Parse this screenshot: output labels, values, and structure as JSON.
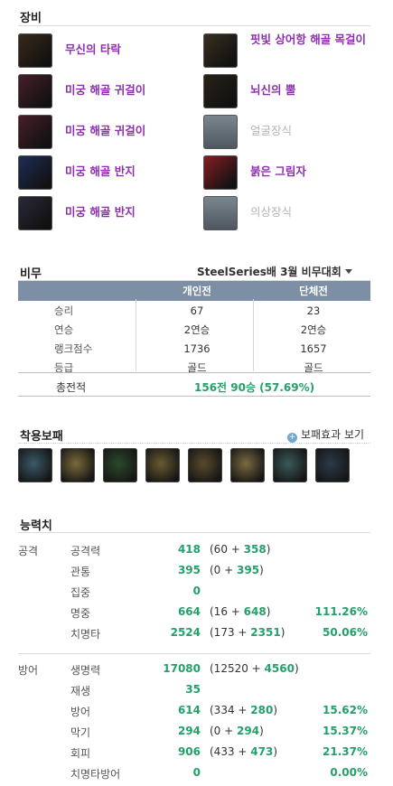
{
  "equipment": {
    "title": "장비",
    "left": [
      {
        "name": "무신의 타락",
        "icon": "weapon-icon",
        "color": "#3a2a1a"
      },
      {
        "name": "미궁 해골 귀걸이",
        "icon": "earring-icon",
        "color": "#4a1e2a"
      },
      {
        "name": "미궁 해골 귀걸이",
        "icon": "earring-icon",
        "color": "#4a1e2a"
      },
      {
        "name": "미궁 해골 반지",
        "icon": "ring-icon",
        "color": "#1e2e5a"
      },
      {
        "name": "미궁 해골 반지",
        "icon": "ring-icon",
        "color": "#2a2a3a"
      }
    ],
    "right": [
      {
        "name": "핏빛 상어항 해골 목걸이",
        "icon": "necklace-icon",
        "color": "#3a3020"
      },
      {
        "name": "뇌신의 뿔",
        "icon": "horn-icon",
        "color": "#2a2218"
      },
      {
        "name": "얼굴장식",
        "icon": "face-accessory-icon",
        "color": "#5b6670",
        "empty": true
      },
      {
        "name": "붉은 그림자",
        "icon": "costume-icon",
        "color": "#8a1e24"
      },
      {
        "name": "의상장식",
        "icon": "costume-accessory-icon",
        "color": "#5b6670",
        "empty": true
      }
    ]
  },
  "bimu": {
    "title": "비무",
    "dropdown": "SteelSeries배 3월 비무대회",
    "columns": [
      "",
      "개인전",
      "단체전"
    ],
    "rows": [
      {
        "label": "승리",
        "solo": "67",
        "team": "23"
      },
      {
        "label": "연승",
        "solo": "2연승",
        "team": "2연승"
      },
      {
        "label": "랭크점수",
        "solo": "1736",
        "team": "1657"
      },
      {
        "label": "등급",
        "solo": "골드",
        "team": "골드"
      }
    ],
    "total_label": "총전적",
    "total_value": "156전 90승 (57.69%)"
  },
  "soulshield": {
    "title": "착용보패",
    "link": "보패효과 보기",
    "pieces": [
      {
        "icon": "soulshield-1-icon"
      },
      {
        "icon": "soulshield-2-icon"
      },
      {
        "icon": "soulshield-3-icon"
      },
      {
        "icon": "soulshield-4-icon"
      },
      {
        "icon": "soulshield-5-icon"
      },
      {
        "icon": "soulshield-6-icon"
      },
      {
        "icon": "soulshield-7-icon"
      },
      {
        "icon": "soulshield-8-icon"
      }
    ]
  },
  "stats": {
    "title": "능력치",
    "attack": {
      "category": "공격",
      "rows": [
        {
          "name": "공격력",
          "value": "418",
          "base": "60",
          "bonus": "358",
          "pct": ""
        },
        {
          "name": "관통",
          "value": "395",
          "base": "0",
          "bonus": "395",
          "pct": ""
        },
        {
          "name": "집중",
          "value": "0",
          "base": "",
          "bonus": "",
          "pct": ""
        },
        {
          "name": "명중",
          "value": "664",
          "base": "16",
          "bonus": "648",
          "pct": "111.26%"
        },
        {
          "name": "치명타",
          "value": "2524",
          "base": "173",
          "bonus": "2351",
          "pct": "50.06%"
        }
      ]
    },
    "defense": {
      "category": "방어",
      "rows": [
        {
          "name": "생명력",
          "value": "17080",
          "base": "12520",
          "bonus": "4560",
          "pct": ""
        },
        {
          "name": "재생",
          "value": "35",
          "base": "",
          "bonus": "",
          "pct": ""
        },
        {
          "name": "방어",
          "value": "614",
          "base": "334",
          "bonus": "280",
          "pct": "15.62%"
        },
        {
          "name": "막기",
          "value": "294",
          "base": "0",
          "bonus": "294",
          "pct": "15.37%"
        },
        {
          "name": "회피",
          "value": "906",
          "base": "433",
          "bonus": "473",
          "pct": "21.37%"
        },
        {
          "name": "치명타방어",
          "value": "0",
          "base": "",
          "bonus": "",
          "pct": "0.00%"
        }
      ]
    }
  }
}
